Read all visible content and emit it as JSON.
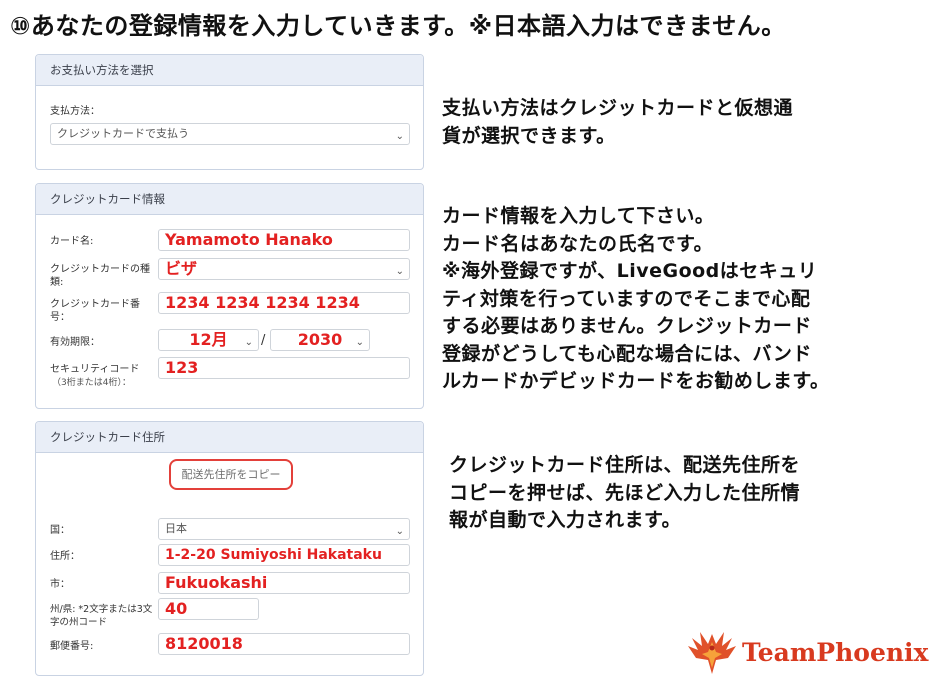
{
  "title": "⑩あなたの登録情報を入力していきます。※日本語入力はできません。",
  "payment": {
    "header": "お支払い方法を選択",
    "method_label": "支払方法：",
    "method_value": "クレジットカードで支払う"
  },
  "card": {
    "header": "クレジットカード情報",
    "name_label": "カード名:",
    "name_value": "Yamamoto Hanako",
    "type_label": "クレジットカードの種類:",
    "type_value": "ビザ",
    "number_label": "クレジットカード番号：",
    "number_value": "1234 1234 1234 1234",
    "expiry_label": "有効期限：",
    "expiry_month": "12月",
    "expiry_sep": "/",
    "expiry_year": "2030",
    "cvc_label": "セキュリティコード",
    "cvc_sub": "（3桁または4桁）：",
    "cvc_value": "123"
  },
  "address": {
    "header": "クレジットカード住所",
    "copy_button": "配送先住所をコピー",
    "country_label": "国：",
    "country_value": "日本",
    "street_label": "住所：",
    "street_value": "1-2-20 Sumiyoshi Hakataku",
    "city_label": "市：",
    "city_value": "Fukuokashi",
    "state_label": "州/県: *2文字または3文字の州コード",
    "state_value": "40",
    "zip_label": "郵便番号:",
    "zip_value": "8120018"
  },
  "notes": {
    "payment_note": [
      "支払い方法はクレジットカードと仮想通",
      "貨が選択できます。"
    ],
    "card_note": [
      "カード情報を入力して下さい。",
      "カード名はあなたの氏名です。",
      "※海外登録ですが、LiveGoodはセキュリ",
      "ティ対策を行っていますのでそこまで心配",
      "する必要はありません。クレジットカード",
      "登録がどうしても心配な場合には、バンド",
      "ルカードかデビッドカードをお勧めします。"
    ],
    "address_note": [
      "クレジットカード住所は、配送先住所を",
      "コピーを押せば、先ほど入力した住所情",
      "報が自動で入力されます。"
    ]
  },
  "brand": {
    "name": "TeamPhoenix",
    "color": "#d83a1f"
  },
  "colors": {
    "accent_red": "#e32121",
    "panel_header": "#e9eef7"
  },
  "icons": {
    "select_arrow": "chevron-down-icon",
    "logo": "phoenix-icon"
  }
}
